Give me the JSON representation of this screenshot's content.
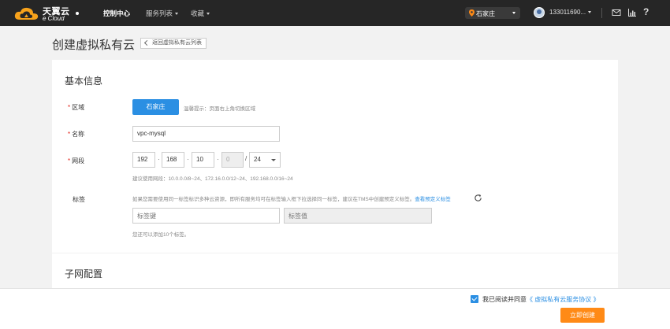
{
  "topbar": {
    "brand_cn": "天翼云",
    "brand_en": "e Cloud",
    "nav": [
      {
        "label": "控制中心",
        "active": true
      },
      {
        "label": "服务列表",
        "dropdown": true
      },
      {
        "label": "收藏",
        "dropdown": true
      }
    ],
    "region": "石家庄",
    "user": "133011690...",
    "icons": [
      "mail-icon",
      "chart-icon",
      "help-icon"
    ],
    "help_glyph": "?"
  },
  "page": {
    "title": "创建虚拟私有云",
    "back_label": "返回虚拟私有云列表"
  },
  "basic": {
    "section_title": "基本信息",
    "region_label": "区域",
    "region_value": "石家庄",
    "region_hint": "温馨提示：页面右上角切换区域",
    "name_label": "名称",
    "name_value": "vpc-mysql",
    "cidr_label": "网段",
    "cidr": [
      "192",
      "168",
      "10",
      "0"
    ],
    "cidr_dot": "·",
    "cidr_slash": "/",
    "mask": "24",
    "cidr_hint": "建议使用网段：10.0.0.0/8~24、172.16.0.0/12~24、192.168.0.0/16~24",
    "tag_label": "标签",
    "tag_desc": "如果您需要使用同一标签标识多种云资源，即所有服务均可在标签输入框下拉选择同一标签，建议在TMS中创建预定义标签。",
    "tag_link": "查看预定义标签",
    "tag_key_placeholder": "标签键",
    "tag_value_placeholder": "标签值",
    "tag_limit": "您还可以添加10个标签。"
  },
  "subnet": {
    "section_title": "子网配置"
  },
  "footer": {
    "agree_prefix": "我已阅读并同意",
    "agree_link": "《 虚拟私有云服务协议 》",
    "agreed": true,
    "create_label": "立即创建"
  },
  "colors": {
    "topbar": "#262626",
    "primary": "#2b8fe3",
    "orange": "#ff8a16",
    "required": "#e2231a"
  }
}
